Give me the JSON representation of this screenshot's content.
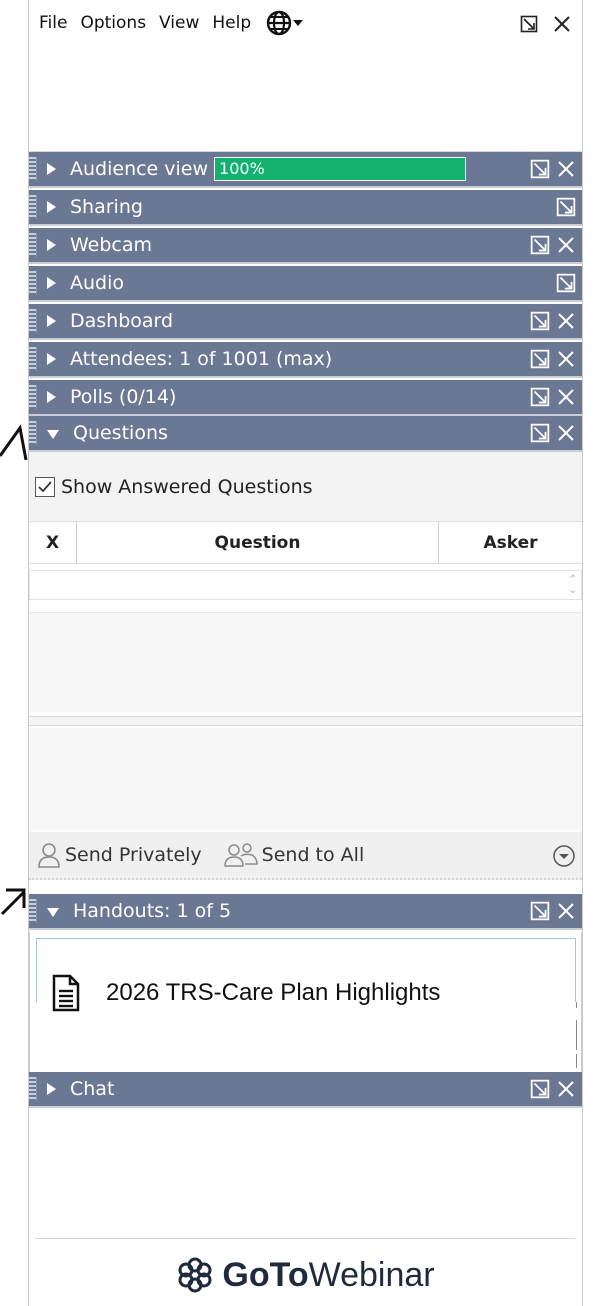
{
  "menu": {
    "items": [
      "File",
      "Options",
      "View",
      "Help"
    ]
  },
  "panels": {
    "audience": {
      "title": "Audience view",
      "progress_text": "100%",
      "progress_value": 100
    },
    "sharing": {
      "title": "Sharing"
    },
    "webcam": {
      "title": "Webcam"
    },
    "audio": {
      "title": "Audio"
    },
    "dashboard": {
      "title": "Dashboard"
    },
    "attendees": {
      "title": "Attendees:  1 of 1001 (max)"
    },
    "polls": {
      "title": "Polls (0/14)"
    },
    "questions": {
      "title": "Questions"
    },
    "handouts": {
      "title": "Handouts: 1 of 5"
    },
    "chat": {
      "title": "Chat"
    }
  },
  "questions": {
    "show_answered_label": "Show Answered Questions",
    "show_answered_checked": true,
    "columns": {
      "x": "X",
      "question": "Question",
      "asker": "Asker"
    },
    "send_privately": "Send Privately",
    "send_to_all": "Send to All"
  },
  "handouts": {
    "items": [
      {
        "label": "2026 TRS-Care Plan Highlights"
      }
    ]
  },
  "brand": {
    "bold": "GoTo",
    "light": "Webinar"
  },
  "colors": {
    "panel_bar": "#6b7893",
    "progress_green": "#12b26e",
    "accent_blue": "#a7c5e8"
  }
}
